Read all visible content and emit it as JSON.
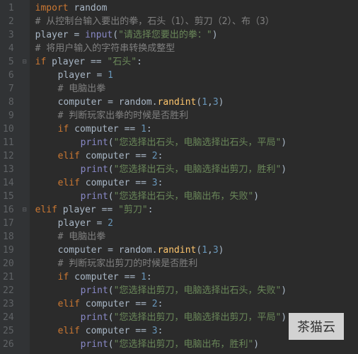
{
  "gutter": [
    "1",
    "2",
    "3",
    "4",
    "5",
    "6",
    "7",
    "8",
    "9",
    "10",
    "11",
    "12",
    "13",
    "14",
    "15",
    "16",
    "17",
    "18",
    "19",
    "20",
    "21",
    "22",
    "23",
    "24",
    "25",
    "26"
  ],
  "fold": {
    "l5": "⊟",
    "l16": "⊟"
  },
  "code": {
    "l1": {
      "kw": "import",
      "sp": " ",
      "mod": "random"
    },
    "l2": {
      "com": "# 从控制台输入要出的拳，石头（1）、剪刀（2）、布（3）"
    },
    "l3": {
      "id": "player",
      "sp1": " ",
      "op": "=",
      "sp2": " ",
      "fn": "input",
      "p1": "(",
      "str": "\"请选择您要出的拳：\"",
      "p2": ")"
    },
    "l4": {
      "com": "# 将用户输入的字符串转换成整型"
    },
    "l5": {
      "kw": "if",
      "sp": " ",
      "id": "player",
      "sp2": " ",
      "op": "==",
      "sp3": " ",
      "str": "\"石头\"",
      "col": ":"
    },
    "l6": {
      "id": "player",
      "sp1": " ",
      "op": "=",
      "sp2": " ",
      "num": "1"
    },
    "l7": {
      "com": "# 电脑出拳"
    },
    "l8": {
      "id": "computer",
      "sp1": " ",
      "op": "=",
      "sp2": " ",
      "mod": "random",
      "dot": ".",
      "fn": "randint",
      "p1": "(",
      "n1": "1",
      "comma": ",",
      "n2": "3",
      "p2": ")"
    },
    "l9": {
      "com": "# 判断玩家出拳的时候是否胜利"
    },
    "l10": {
      "kw": "if",
      "sp": " ",
      "id": "computer",
      "sp2": " ",
      "op": "==",
      "sp3": " ",
      "num": "1",
      "col": ":"
    },
    "l11": {
      "fn": "print",
      "p1": "(",
      "str": "\"您选择出石头，电脑选择出石头，平局\"",
      "p2": ")"
    },
    "l12": {
      "kw": "elif",
      "sp": " ",
      "id": "computer",
      "sp2": " ",
      "op": "==",
      "sp3": " ",
      "num": "2",
      "col": ":"
    },
    "l13": {
      "fn": "print",
      "p1": "(",
      "str": "\"您选择出石头，电脑选择出剪刀，胜利\"",
      "p2": ")"
    },
    "l14": {
      "kw": "elif",
      "sp": " ",
      "id": "computer",
      "sp2": " ",
      "op": "==",
      "sp3": " ",
      "num": "3",
      "col": ":"
    },
    "l15": {
      "fn": "print",
      "p1": "(",
      "str": "\"您选择出石头，电脑出布，失败\"",
      "p2": ")"
    },
    "l16": {
      "kw": "elif",
      "sp": " ",
      "id": "player",
      "sp2": " ",
      "op": "==",
      "sp3": " ",
      "str": "\"剪刀\"",
      "col": ":"
    },
    "l17": {
      "id": "player",
      "sp1": " ",
      "op": "=",
      "sp2": " ",
      "num": "2"
    },
    "l18": {
      "com": "# 电脑出拳"
    },
    "l19": {
      "id": "computer",
      "sp1": " ",
      "op": "=",
      "sp2": " ",
      "mod": "random",
      "dot": ".",
      "fn": "randint",
      "p1": "(",
      "n1": "1",
      "comma": ",",
      "n2": "3",
      "p2": ")"
    },
    "l20": {
      "com": "# 判断玩家出剪刀的时候是否胜利"
    },
    "l21": {
      "kw": "if",
      "sp": " ",
      "id": "computer",
      "sp2": " ",
      "op": "==",
      "sp3": " ",
      "num": "1",
      "col": ":"
    },
    "l22": {
      "fn": "print",
      "p1": "(",
      "str": "\"您选择出剪刀，电脑选择出石头，失败\"",
      "p2": ")"
    },
    "l23": {
      "kw": "elif",
      "sp": " ",
      "id": "computer",
      "sp2": " ",
      "op": "==",
      "sp3": " ",
      "num": "2",
      "col": ":"
    },
    "l24": {
      "fn": "print",
      "p1": "(",
      "str": "\"您选择出剪刀，电脑选择出剪刀，平局\"",
      "p2": ")"
    },
    "l25": {
      "kw": "elif",
      "sp": " ",
      "id": "computer",
      "sp2": " ",
      "op": "==",
      "sp3": " ",
      "num": "3",
      "col": ":"
    },
    "l26": {
      "fn": "print",
      "p1": "(",
      "str": "\"您选择出剪刀，电脑出布，胜利\"",
      "p2": ")"
    }
  },
  "watermark": "茶猫云"
}
